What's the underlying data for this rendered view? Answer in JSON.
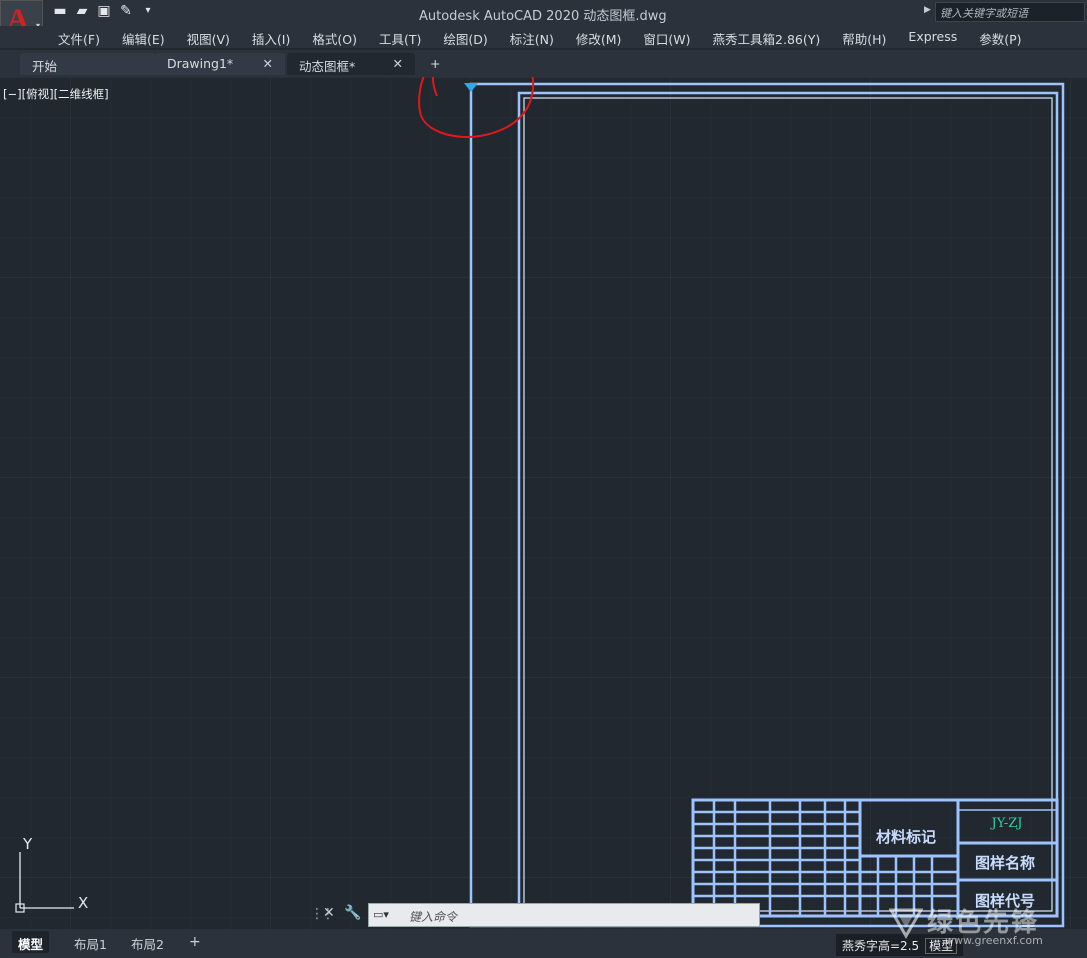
{
  "title": {
    "app_title": "Autodesk AutoCAD 2020    动态图框.dwg",
    "search_placeholder": "键入关键字或短语"
  },
  "menu": [
    "文件(F)",
    "编辑(E)",
    "视图(V)",
    "插入(I)",
    "格式(O)",
    "工具(T)",
    "绘图(D)",
    "标注(N)",
    "修改(M)",
    "窗口(W)",
    "燕秀工具箱2.86(Y)",
    "帮助(H)",
    "Express",
    "参数(P)"
  ],
  "tabs": {
    "start": "开始",
    "drawing1": "Drawing1*",
    "dynamic": "动态图框*",
    "add": "+"
  },
  "viewport_label": "[−][俯视][二维线框]",
  "title_block": {
    "material_label": "材料标记",
    "code": "JY-ZJ",
    "drawing_name": "图样名称",
    "drawing_number": "图样代号"
  },
  "ucs": {
    "y": "Y",
    "x": "X"
  },
  "command": {
    "placeholder": "键入命令"
  },
  "layout_tabs": [
    "模型",
    "布局1",
    "布局2",
    "+"
  ],
  "status": {
    "text_height": "燕秀字高=2.5",
    "mode": "模型"
  },
  "watermark": {
    "name": "绿色先锋",
    "url": "www.greenxf.com"
  },
  "colors": {
    "accent": "#3b8fd9",
    "frame": "#8fb7ff",
    "annotation": "#e01818",
    "title_green": "#2fd0a0"
  }
}
